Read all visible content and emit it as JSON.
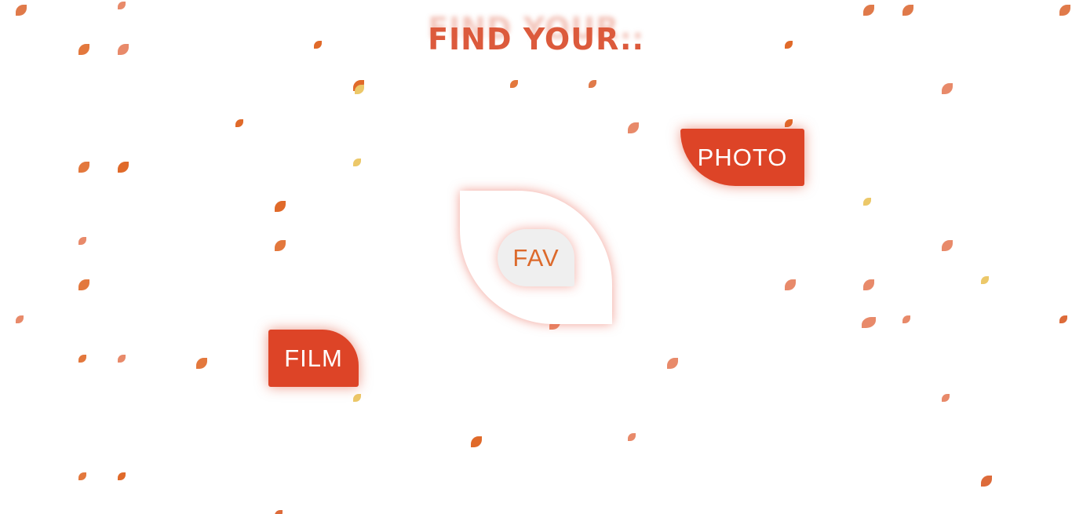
{
  "header": {
    "title": "FIND YOUR.."
  },
  "buttons": {
    "photo_label": "PHOTO",
    "film_label": "FILM",
    "fav_label": "FAV"
  },
  "theme": {
    "accent": "#dd4427",
    "title_color": "#dc5a3c",
    "fav_text_color": "#dc6a2c",
    "fav_bg": "#efefef",
    "confetti_colors": [
      "#e07a4a",
      "#e3783d",
      "#e06a2a",
      "#e88a6a",
      "#ecc869",
      "#dd6b3a"
    ]
  },
  "decor": {
    "confetti_icon": "leaf-confetti-icon"
  }
}
